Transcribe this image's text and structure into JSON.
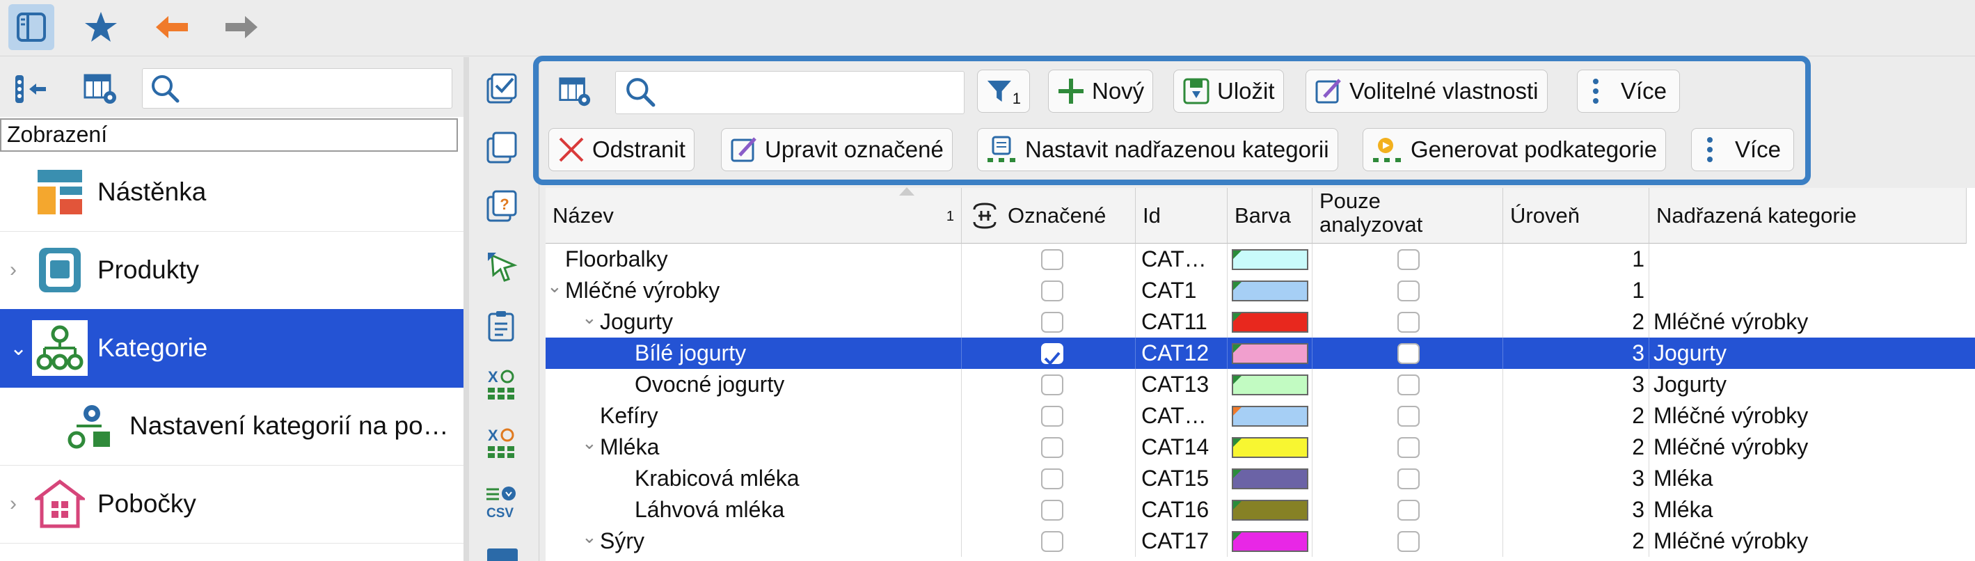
{
  "left": {
    "view_header": "Zobrazení",
    "nav": [
      {
        "label": "Nástěnka",
        "icon": "dashboard-icon"
      },
      {
        "label": "Produkty",
        "icon": "products-icon"
      },
      {
        "label": "Kategorie",
        "icon": "categories-icon"
      },
      {
        "label": "Nastavení kategorií na po…",
        "icon": "category-settings-icon"
      },
      {
        "label": "Pobočky",
        "icon": "branches-icon"
      }
    ]
  },
  "toolbar": {
    "new": "Nový",
    "save": "Uložit",
    "custom_props": "Volitelné vlastnosti",
    "more": "Více",
    "delete": "Odstranit",
    "edit_marked": "Upravit označené",
    "set_parent": "Nastavit nadřazenou kategorii",
    "gen_sub": "Generovat podkategorie",
    "more2": "Více",
    "filter_count": "1"
  },
  "grid": {
    "columns": {
      "name": "Název",
      "name_sort": "1",
      "marked": "Označené",
      "id": "Id",
      "color": "Barva",
      "analyze_only": "Pouze analyzovat",
      "level": "Úroveň",
      "parent": "Nadřazená kategorie"
    },
    "rows": [
      {
        "name": "Floorbalky",
        "indent": 0,
        "twisty": "",
        "marked": false,
        "id": "CAT…",
        "color": "#c9fbfb",
        "level": "1",
        "parent": ""
      },
      {
        "name": "Mléčné výrobky",
        "indent": 0,
        "twisty": "⌄",
        "marked": false,
        "id": "CAT1",
        "color": "#a6cff5",
        "level": "1",
        "parent": ""
      },
      {
        "name": "Jogurty",
        "indent": 1,
        "twisty": "⌄",
        "marked": false,
        "id": "CAT11",
        "color": "#e8281e",
        "level": "2",
        "parent": "Mléčné výrobky"
      },
      {
        "name": "Bílé jogurty",
        "indent": 2,
        "twisty": "",
        "marked": true,
        "id": "CAT12",
        "color": "#f19fce",
        "level": "3",
        "parent": "Jogurty",
        "selected": true
      },
      {
        "name": "Ovocné jogurty",
        "indent": 2,
        "twisty": "",
        "marked": false,
        "id": "CAT13",
        "color": "#c2fbc2",
        "level": "3",
        "parent": "Jogurty"
      },
      {
        "name": "Kefíry",
        "indent": 1,
        "twisty": "",
        "marked": false,
        "id": "CAT…",
        "color": "#a6cff5",
        "level": "2",
        "parent": "Mléčné výrobky"
      },
      {
        "name": "Mléka",
        "indent": 1,
        "twisty": "⌄",
        "marked": false,
        "id": "CAT14",
        "color": "#f8f631",
        "level": "2",
        "parent": "Mléčné výrobky"
      },
      {
        "name": "Krabicová mléka",
        "indent": 2,
        "twisty": "",
        "marked": false,
        "id": "CAT15",
        "color": "#6b63a6",
        "level": "3",
        "parent": "Mléka"
      },
      {
        "name": "Láhvová mléka",
        "indent": 2,
        "twisty": "",
        "marked": false,
        "id": "CAT16",
        "color": "#868125",
        "level": "3",
        "parent": "Mléka"
      },
      {
        "name": "Sýry",
        "indent": 1,
        "twisty": "⌄",
        "marked": false,
        "id": "CAT17",
        "color": "#e827e6",
        "level": "2",
        "parent": "Mléčné výrobky"
      }
    ]
  }
}
